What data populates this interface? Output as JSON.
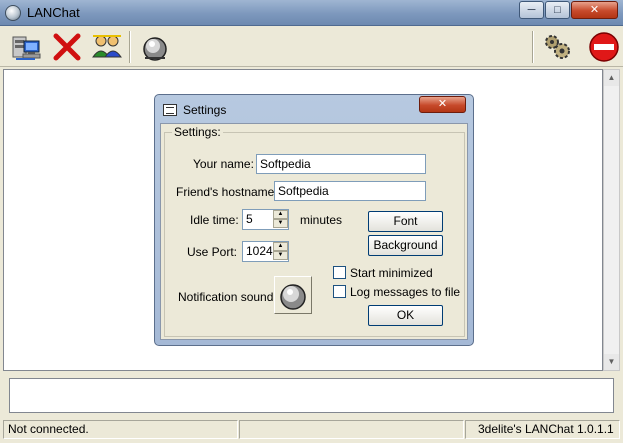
{
  "window": {
    "title": "LANChat",
    "minimize_glyph": "─",
    "maximize_glyph": "□",
    "close_glyph": "✕"
  },
  "toolbar": {
    "buttons": [
      "connect-icon",
      "disconnect-icon",
      "users-icon",
      "sound-icon",
      "settings-icon",
      "exit-icon"
    ]
  },
  "scrollbar": {
    "up_glyph": "▲",
    "down_glyph": "▼"
  },
  "statusbar": {
    "status": "Not connected.",
    "middle": "",
    "version": "3delite's LANChat 1.0.1.1"
  },
  "settings_dialog": {
    "title": "Settings",
    "close_glyph": "✕",
    "group_label": "Settings:",
    "your_name_label": "Your name:",
    "your_name_value": "Softpedia",
    "friend_hostname_label": "Friend's hostname:",
    "friend_hostname_value": "Softpedia",
    "idle_time_label": "Idle time:",
    "idle_time_value": "5",
    "idle_time_unit": "minutes",
    "use_port_label": "Use Port:",
    "use_port_value": "1024",
    "font_button": "Font",
    "background_button": "Background",
    "start_minimized_label": "Start minimized",
    "start_minimized_checked": false,
    "log_messages_label": "Log messages to file",
    "log_messages_checked": false,
    "notification_sound_label": "Notification sound:",
    "ok_button": "OK"
  }
}
